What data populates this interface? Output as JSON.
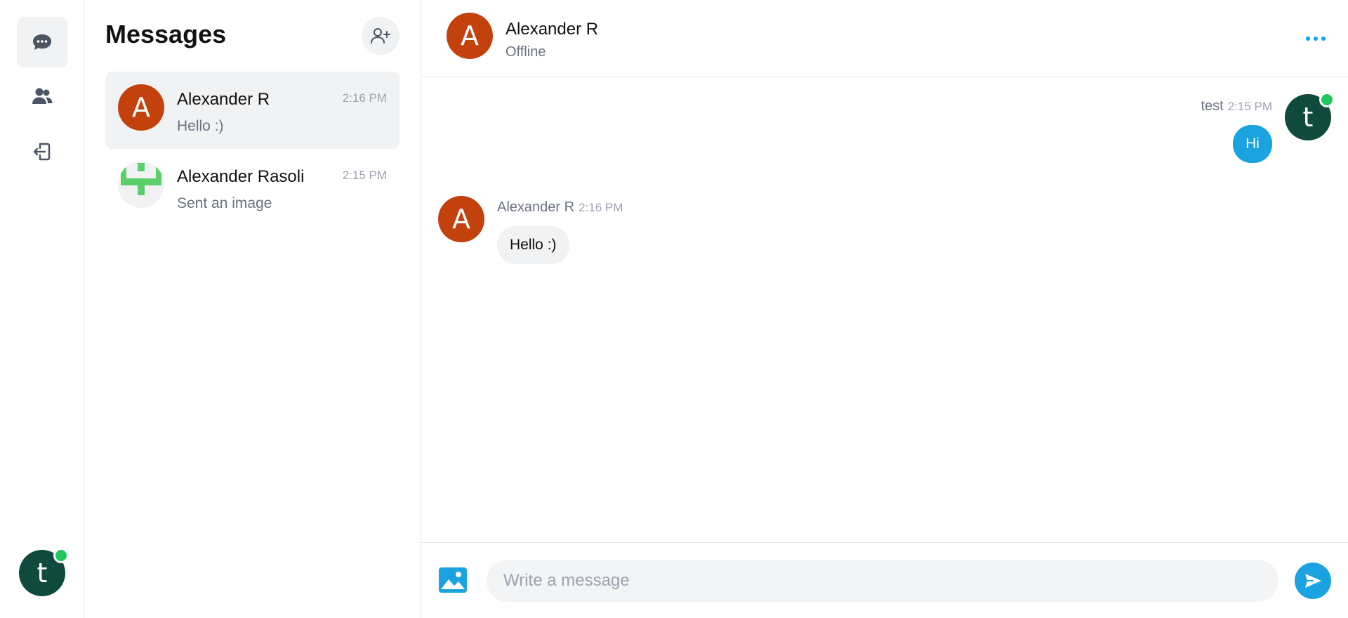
{
  "rail": {
    "user_initial": "t",
    "user_online": true
  },
  "list": {
    "title": "Messages",
    "conversations": [
      {
        "name": "Alexander R",
        "time": "2:16 PM",
        "preview": "Hello :)",
        "initial": "A",
        "active": true
      },
      {
        "name": "Alexander Rasoli",
        "time": "2:15 PM",
        "preview": "Sent an image",
        "active": false
      }
    ]
  },
  "chat": {
    "header": {
      "name": "Alexander R",
      "status": "Offline",
      "initial": "A"
    },
    "messages": [
      {
        "direction": "outgoing",
        "sender": "test",
        "time": "2:15 PM",
        "text": "Hi",
        "initial": "t",
        "online": true
      },
      {
        "direction": "incoming",
        "sender": "Alexander R",
        "time": "2:16 PM",
        "text": "Hello :)",
        "initial": "A"
      }
    ],
    "composer": {
      "placeholder": "Write a message",
      "value": ""
    }
  },
  "colors": {
    "accent": "#1aa3e0",
    "avatar_red": "#c2410c",
    "avatar_dark": "#0f4a3c",
    "online": "#22c55e"
  },
  "icons": {
    "rail": [
      "chat-bubble-icon",
      "users-icon",
      "logout-icon"
    ],
    "list": [
      "add-user-icon"
    ],
    "chat": [
      "more-dots-icon",
      "image-icon",
      "send-icon"
    ]
  }
}
